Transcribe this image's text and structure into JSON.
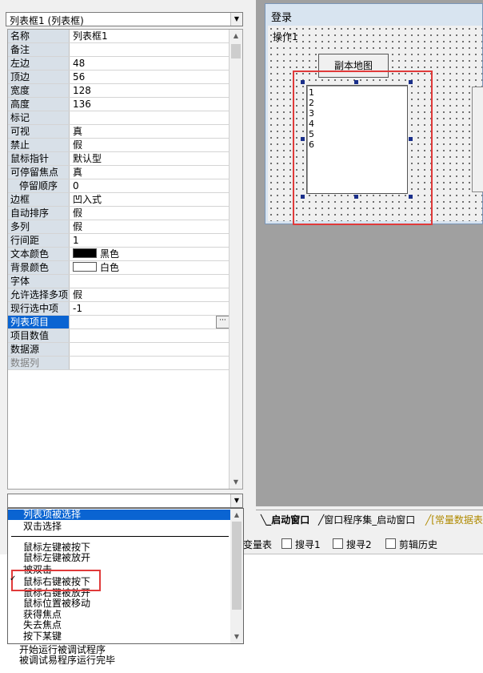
{
  "object_selector": {
    "value": "列表框1 (列表框)"
  },
  "properties": [
    {
      "name": "名称",
      "value": "列表框1"
    },
    {
      "name": "备注",
      "value": ""
    },
    {
      "name": "左边",
      "value": "48"
    },
    {
      "name": "顶边",
      "value": "56"
    },
    {
      "name": "宽度",
      "value": "128"
    },
    {
      "name": "高度",
      "value": "136"
    },
    {
      "name": "标记",
      "value": ""
    },
    {
      "name": "可视",
      "value": "真"
    },
    {
      "name": "禁止",
      "value": "假"
    },
    {
      "name": "鼠标指针",
      "value": "默认型"
    },
    {
      "name": "可停留焦点",
      "value": "真"
    },
    {
      "name": "停留顺序",
      "value": "0"
    },
    {
      "name": "边框",
      "value": "凹入式"
    },
    {
      "name": "自动排序",
      "value": "假"
    },
    {
      "name": "多列",
      "value": "假"
    },
    {
      "name": "行间距",
      "value": "1"
    },
    {
      "name": "文本颜色",
      "value": "黑色",
      "swatch": "#000000"
    },
    {
      "name": "背景颜色",
      "value": "白色",
      "swatch": "#ffffff"
    },
    {
      "name": "字体",
      "value": ""
    },
    {
      "name": "允许选择多项",
      "value": "假"
    },
    {
      "name": "现行选中项",
      "value": "-1"
    },
    {
      "name": "列表项目",
      "value": ""
    },
    {
      "name": "项目数值",
      "value": ""
    },
    {
      "name": "数据源",
      "value": ""
    },
    {
      "name": "数据列",
      "value": ""
    }
  ],
  "event_list": {
    "items": [
      "列表项被选择",
      "双击选择",
      "鼠标左键被按下",
      "鼠标左键被放开",
      "被双击",
      "鼠标右键被按下",
      "鼠标右键被放开",
      "鼠标位置被移动",
      "获得焦点",
      "失去焦点",
      "按下某键"
    ],
    "selected": "列表项被选择",
    "checked": "鼠标右键被按下"
  },
  "output_lines": [
    "开始运行被调试程序",
    "被调试易程序运行完毕"
  ],
  "form": {
    "title": "登录",
    "menu": "操作1",
    "button_label": "副本地图",
    "listbox_items": [
      "1",
      "2",
      "3",
      "4",
      "5",
      "6"
    ]
  },
  "tabs": [
    "启动窗口",
    "窗口程序集_启动窗口",
    "[常量数据表"
  ],
  "lower_tabs": [
    "变量表",
    "搜寻1",
    "搜寻2",
    "剪辑历史"
  ],
  "colors": {
    "highlight": "#0a64d2",
    "annotation": "#e03a3a",
    "tab_active_text": "#000000",
    "tab_const_text": "#b08a00"
  }
}
